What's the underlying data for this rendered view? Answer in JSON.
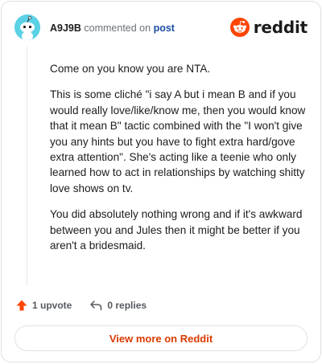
{
  "comment": {
    "author": "A9J9B",
    "commented_on": "commented on",
    "post_link": "post",
    "paragraphs": [
      "Come on you know you are NTA.",
      "This is some cliché \"i say A but i mean B and if you would really love/like/know me, then you would know that it mean B\" tactic combined with the \"I won't give you any hints but you have to fight extra hard/gove extra attention\". She's acting like a teenie who only learned how to act in relationships by watching shitty love shows on tv.",
      "You did absolutely nothing wrong and if it's awkward between you and Jules then it might be better if you aren't a bridesmaid."
    ]
  },
  "brand": {
    "name": "reddit",
    "color": "#ff4500"
  },
  "actions": {
    "upvote_label": "1 upvote",
    "replies_label": "0 replies"
  },
  "footer": {
    "view_more_label": "View more on Reddit"
  },
  "icons": {
    "avatar": "snoo-avatar-icon",
    "logo": "reddit-snoo-icon",
    "upvote": "upvote-arrow-icon",
    "reply": "reply-arrow-icon"
  }
}
